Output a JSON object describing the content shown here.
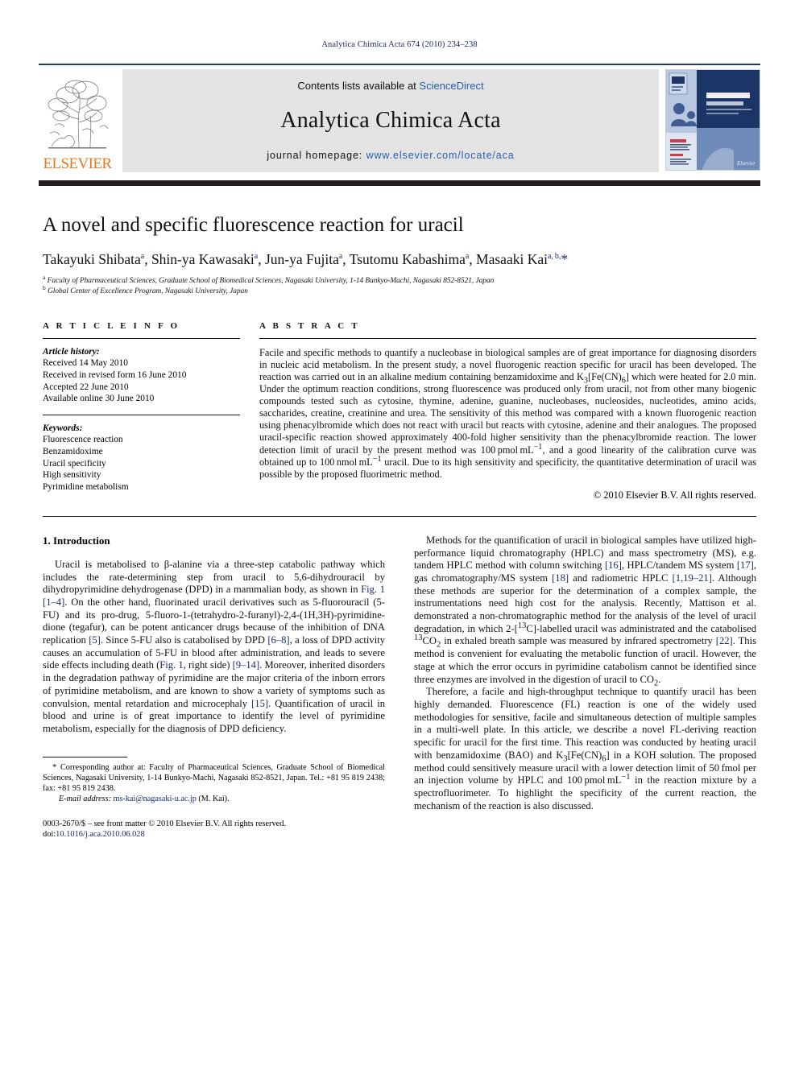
{
  "running_head": "Analytica Chimica Acta 674 (2010) 234–238",
  "masthead": {
    "contents_prefix": "Contents lists available at ",
    "sciencedirect": "ScienceDirect",
    "journal_name": "Analytica Chimica Acta",
    "homepage_prefix": "journal homepage: ",
    "homepage_url": "www.elsevier.com/locate/aca",
    "publisher_wordmark": "ELSEVIER",
    "cover_title_line1": "ANALYTICA",
    "cover_title_line2": "CHIMICA ACTA",
    "colors": {
      "link": "#2a5db0",
      "elsevier_orange": "#e87722",
      "rule_navy": "#24366e",
      "band_grey": "#e3e3e3"
    }
  },
  "article": {
    "title": "A novel and specific fluorescence reaction for uracil",
    "authors_html": "Takayuki Shibata<sup>a</sup>, Shin-ya Kawasaki<sup>a</sup>, Jun-ya Fujita<sup>a</sup>, Tsutomu Kabashima<sup>a</sup>, Masaaki Kai<sup>a, b,</sup><span class=\"star\">*</span>",
    "affiliation_a": "Faculty of Pharmaceutical Sciences, Graduate School of Biomedical Sciences, Nagasaki University, 1-14 Bunkyo-Machi, Nagasaki 852-8521, Japan",
    "affiliation_b": "Global Center of Excellence Program, Nagasaki University, Japan"
  },
  "article_info": {
    "heading": "A R T I C L E   I N F O",
    "history_label": "Article history:",
    "history": [
      "Received 14 May 2010",
      "Received in revised form 16 June 2010",
      "Accepted 22 June 2010",
      "Available online 30 June 2010"
    ],
    "keywords_label": "Keywords:",
    "keywords": [
      "Fluorescence reaction",
      "Benzamidoxime",
      "Uracil specificity",
      "High sensitivity",
      "Pyrimidine metabolism"
    ]
  },
  "abstract": {
    "heading": "A B S T R A C T",
    "body_html": "Facile and specific methods to quantify a nucleobase in biological samples are of great importance for diagnosing disorders in nucleic acid metabolism. In the present study, a novel fluorogenic reaction specific for uracil has been developed. The reaction was carried out in an alkaline medium containing benzamidoxime and K<sub>3</sub>[Fe(CN)<sub>6</sub>] which were heated for 2.0 min. Under the optimum reaction conditions, strong fluorescence was produced only from uracil, not from other many biogenic compounds tested such as cytosine, thymine, adenine, guanine, nucleobases, nucleosides, nucleotides, amino acids, saccharides, creatine, creatinine and urea. The sensitivity of this method was compared with a known fluorogenic reaction using phenacylbromide which does not react with uracil but reacts with cytosine, adenine and their analogues. The proposed uracil-specific reaction showed approximately 400-fold higher sensitivity than the phenacylbromide reaction. The lower detection limit of uracil by the present method was 100&thinsp;pmol&thinsp;mL<sup>−1</sup>, and a good linearity of the calibration curve was obtained up to 100&thinsp;nmol&thinsp;mL<sup>−1</sup> uracil. Due to its high sensitivity and specificity, the quantitative determination of uracil was possible by the proposed fluorimetric method.",
    "copyright": "© 2010 Elsevier B.V. All rights reserved."
  },
  "introduction": {
    "section_title": "1.  Introduction",
    "left_paragraphs_html": [
      "Uracil is metabolised to β-alanine via a three-step catabolic pathway which includes the rate-determining step from uracil to 5,6-dihydrouracil by dihydropyrimidine dehydrogenase (DPD) in a mammalian body, as shown in <span class=\"figlink\">Fig. 1</span> <span class=\"ref\">[1–4]</span>. On the other hand, fluorinated uracil derivatives such as 5-fluorouracil (5-FU) and its pro-drug, 5-fluoro-1-(tetrahydro-2-furanyl)-2,4-(1H,3H)-pyrimidine-dione (tegafur), can be potent anticancer drugs because of the inhibition of DNA replication <span class=\"ref\">[5]</span>. Since 5-FU also is catabolised by DPD <span class=\"ref\">[6–8]</span>, a loss of DPD activity causes an accumulation of 5-FU in blood after administration, and leads to severe side effects including death (<span class=\"figlink\">Fig. 1</span>, right side) <span class=\"ref\">[9–14]</span>. Moreover, inherited disorders in the degradation pathway of pyrimidine are the major criteria of the inborn errors of pyrimidine metabolism, and are known to show a variety of symptoms such as convulsion, mental retardation and microcephaly <span class=\"ref\">[15]</span>. Quantification of uracil in blood and urine is of great importance to identify the level of pyrimidine metabolism, especially for the diagnosis of DPD deficiency."
    ],
    "right_paragraphs_html": [
      "Methods for the quantification of uracil in biological samples have utilized high-performance liquid chromatography (HPLC) and mass spectrometry (MS), e.g. tandem HPLC method with column switching <span class=\"ref\">[16]</span>, HPLC/tandem MS system <span class=\"ref\">[17]</span>, gas chromatography/MS system <span class=\"ref\">[18]</span> and radiometric HPLC <span class=\"ref\">[1,19–21]</span>. Although these methods are superior for the determination of a complex sample, the instrumentations need high cost for the analysis. Recently, Mattison et al. demonstrated a non-chromatographic method for the analysis of the level of uracil degradation, in which 2-[<sup>13</sup>C]-labelled uracil was administrated and the catabolised <sup>13</sup>CO<sub>2</sub> in exhaled breath sample was measured by infrared spectrometry <span class=\"ref\">[22]</span>. This method is convenient for evaluating the metabolic function of uracil. However, the stage at which the error occurs in pyrimidine catabolism cannot be identified since three enzymes are involved in the digestion of uracil to CO<sub>2</sub>.",
      "Therefore, a facile and high-throughput technique to quantify uracil has been highly demanded. Fluorescence (FL) reaction is one of the widely used methodologies for sensitive, facile and simultaneous detection of multiple samples in a multi-well plate. In this article, we describe a novel FL-deriving reaction specific for uracil for the first time. This reaction was conducted by heating uracil with benzamidoxime (BAO) and K<sub>3</sub>[Fe(CN)<sub>6</sub>] in a KOH solution. The proposed method could sensitively measure uracil with a lower detection limit of 50&thinsp;fmol per an injection volume by HPLC and 100&thinsp;pmol&thinsp;mL<sup>−1</sup> in the reaction mixture by a spectrofluorimeter. To highlight the specificity of the current reaction, the mechanism of the reaction is also discussed."
    ]
  },
  "footnote": {
    "corresponding_html": "<span style=\"font-size:11px\">*</span> Corresponding author at: Faculty of Pharmaceutical Sciences, Graduate School of Biomedical Sciences, Nagasaki University, 1-14 Bunkyo-Machi, Nagasaki 852-8521, Japan. Tel.: +81 95 819 2438; fax: +81 95 819 2438.",
    "email_label": "E-mail address:",
    "email": "ms-kai@nagasaki-u.ac.jp",
    "email_owner": "(M. Kai).",
    "issn_line": "0003-2670/$ – see front matter © 2010 Elsevier B.V. All rights reserved.",
    "doi_prefix": "doi:",
    "doi": "10.1016/j.aca.2010.06.028"
  }
}
